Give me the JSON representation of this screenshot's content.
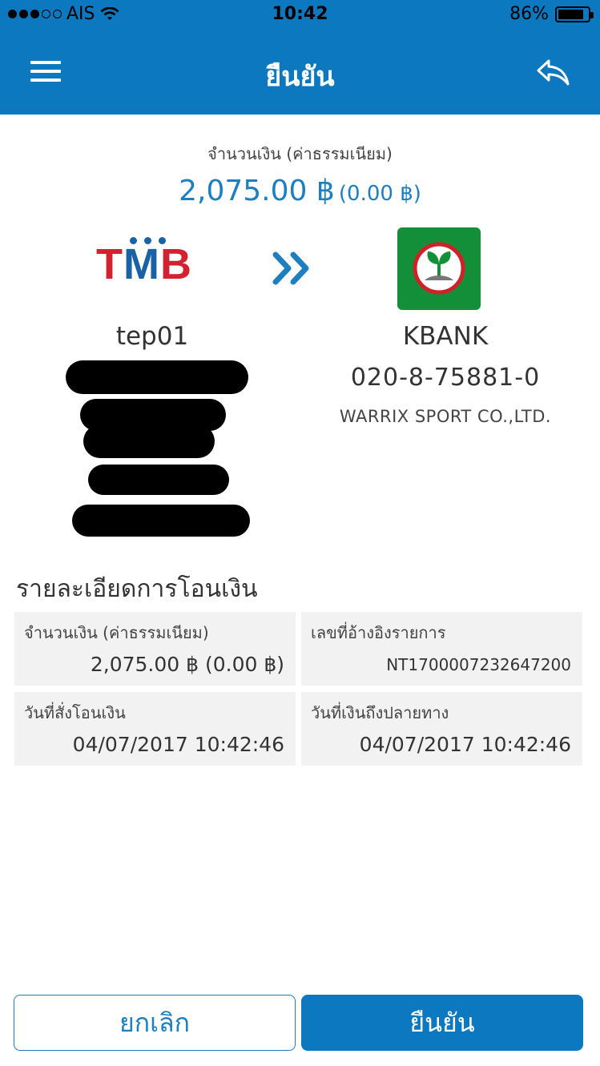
{
  "status_bar": {
    "carrier": "AIS",
    "time": "10:42",
    "battery": "86%",
    "battery_level": 0.86
  },
  "nav": {
    "title": "ยืนยัน",
    "menu_icon": "hamburger-menu-icon",
    "back_icon": "reply-arrow-icon"
  },
  "amount": {
    "label": "จำนวนเงิน (ค่าธรรมเนียม)",
    "value": "2,075.00 ฿",
    "fee": "(0.00 ฿)"
  },
  "transfer": {
    "from_bank": "TMB",
    "from_name": "tep01",
    "to_bank": "KBANK",
    "to_account": "020-8-75881-0",
    "to_owner": "WARRIX SPORT CO.,LTD.",
    "colors": {
      "brand": "#0b78bf",
      "tmb_red": "#d2222f",
      "tmb_blue": "#1a62a6",
      "kbank_green": "#138f3a"
    }
  },
  "details": {
    "title": "รายละเอียดการโอนเงิน",
    "items": [
      {
        "label": "จำนวนเงิน (ค่าธรรมเนียม)",
        "value": "2,075.00 ฿ (0.00 ฿)"
      },
      {
        "label": "เลขที่อ้างอิงรายการ",
        "value": "NT1700007232647200"
      },
      {
        "label": "วันที่สั่งโอนเงิน",
        "value": "04/07/2017 10:42:46"
      },
      {
        "label": "วันที่เงินถึงปลายทาง",
        "value": "04/07/2017 10:42:46"
      }
    ]
  },
  "buttons": {
    "cancel": "ยกเลิก",
    "confirm": "ยืนยัน"
  }
}
